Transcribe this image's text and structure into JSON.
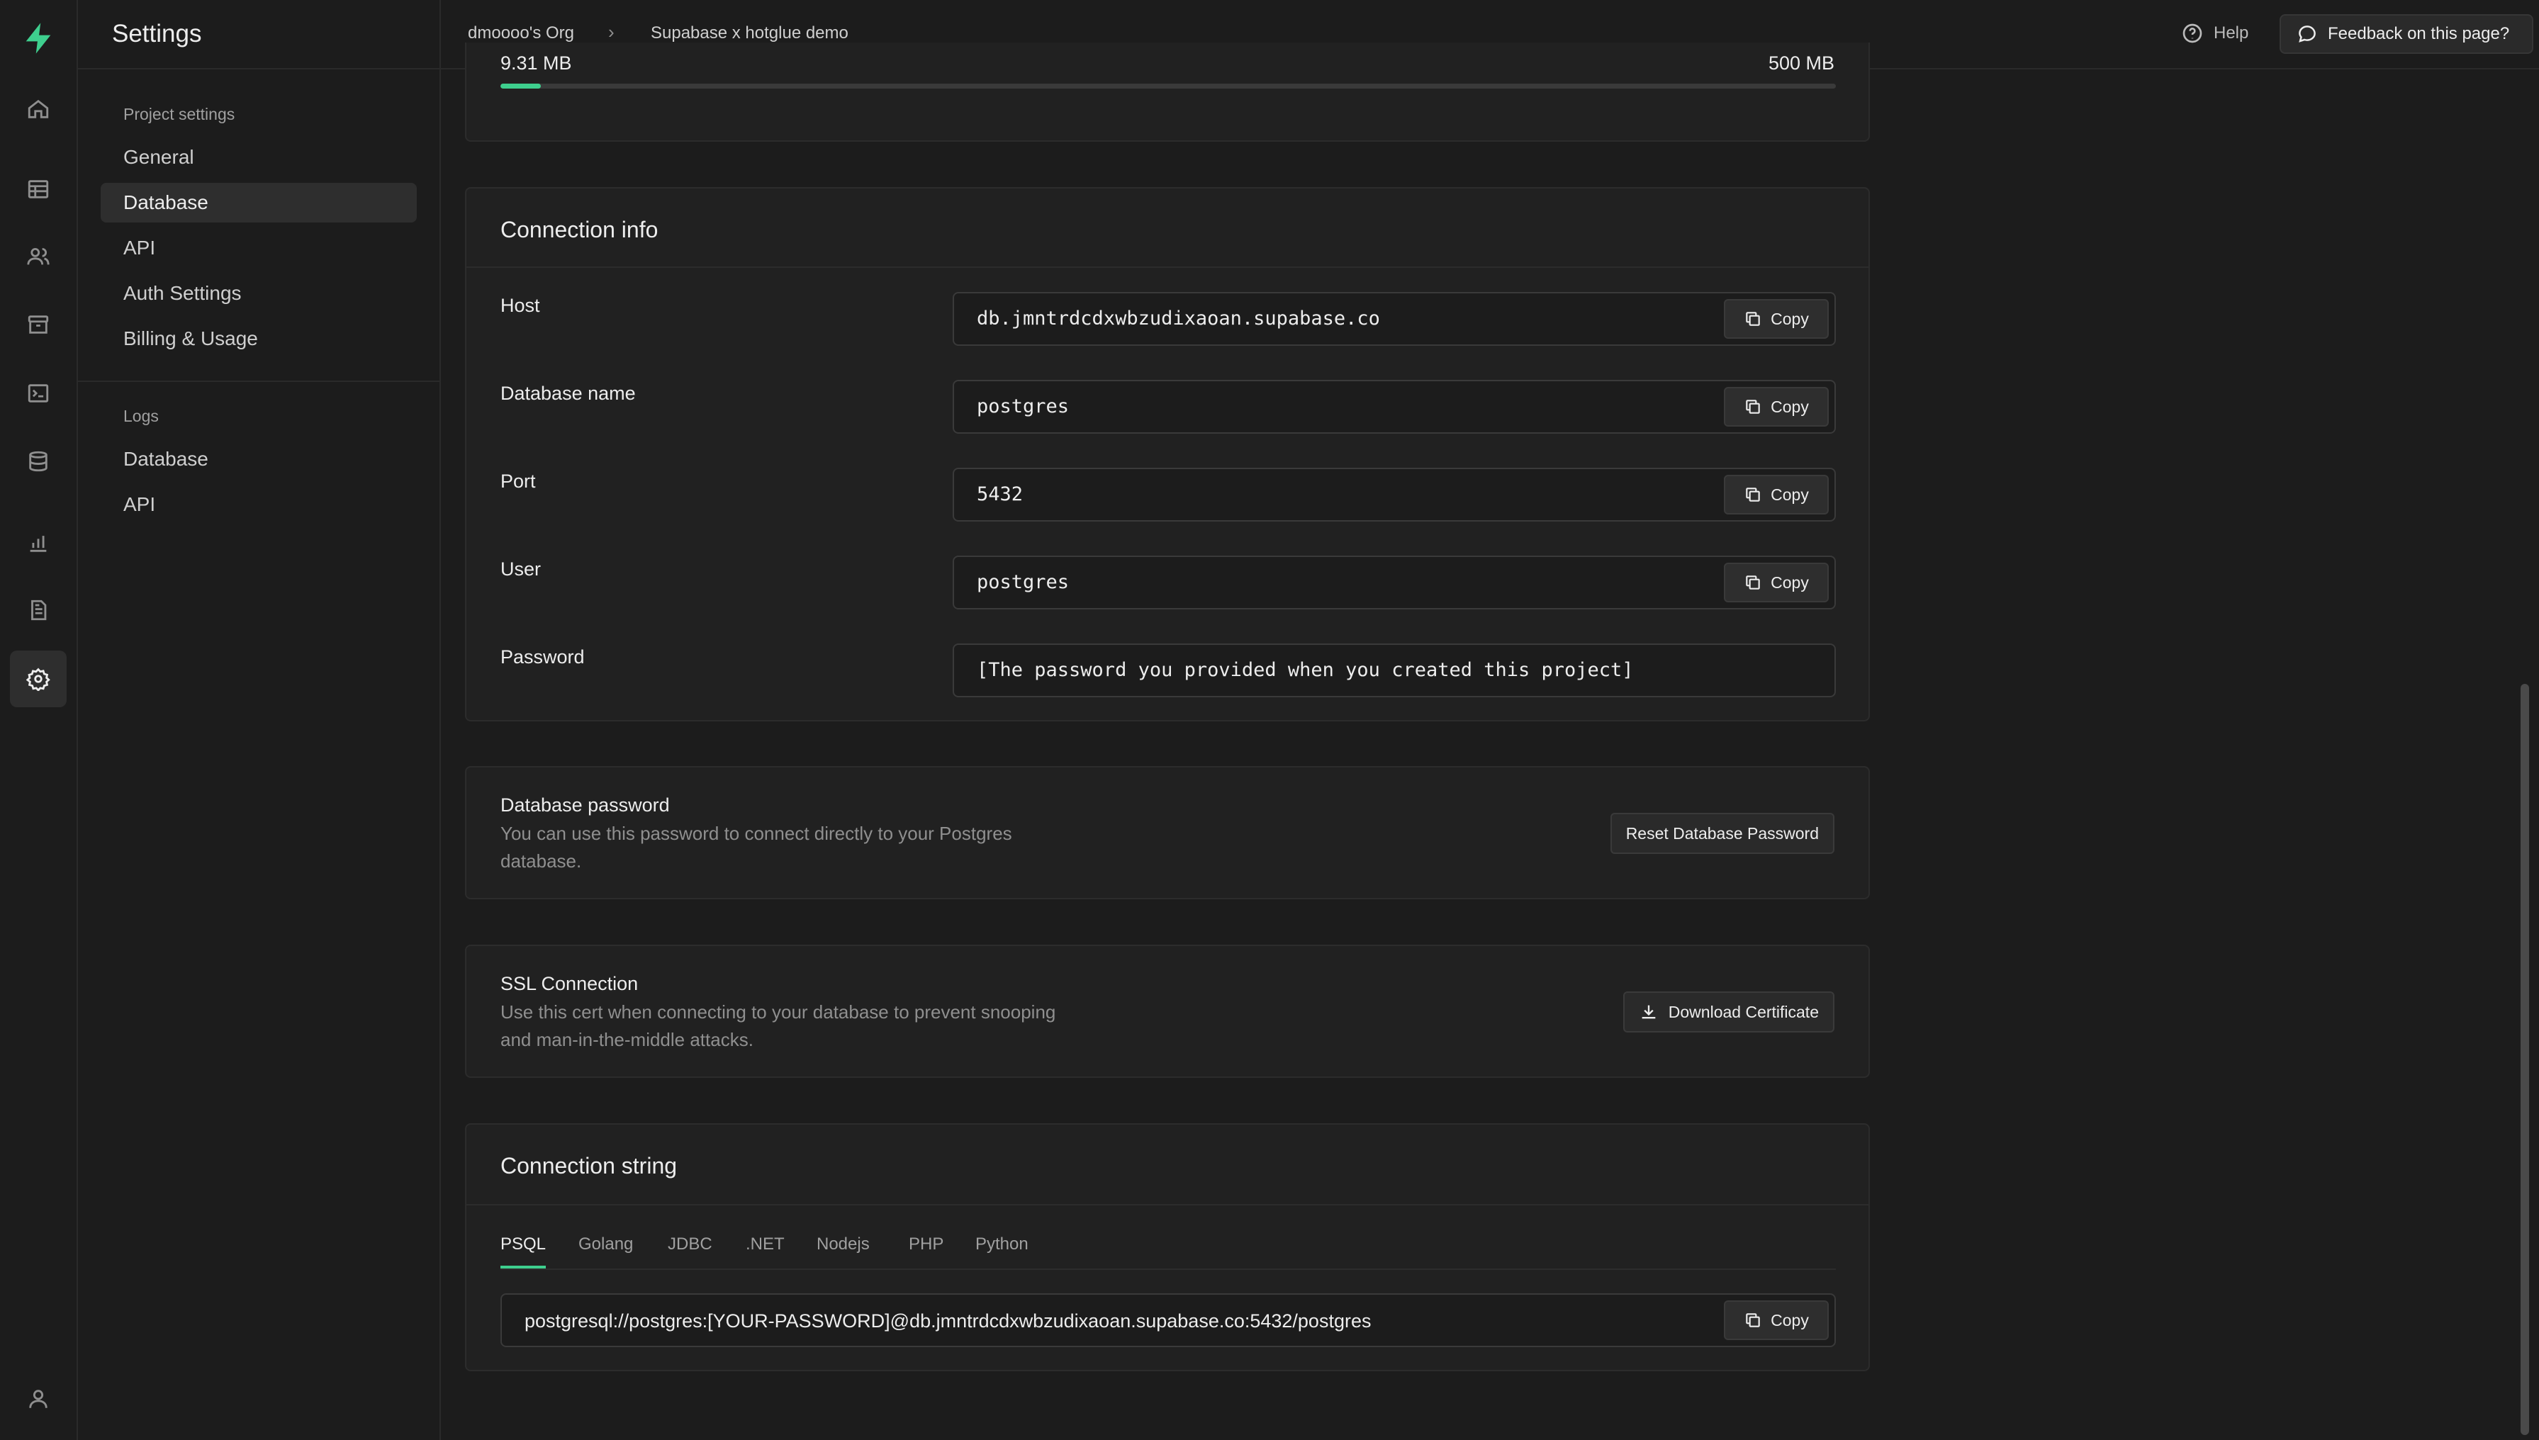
{
  "app": {
    "title": "Settings"
  },
  "rail": {
    "items": [
      "home-icon",
      "table-editor-icon",
      "auth-users-icon",
      "storage-icon",
      "sql-editor-icon",
      "database-icon",
      "reports-icon",
      "api-docs-icon",
      "settings-icon",
      "account-icon"
    ]
  },
  "sidebar": {
    "project_settings_label": "Project settings",
    "project_items": [
      "General",
      "Database",
      "API",
      "Auth Settings",
      "Billing & Usage"
    ],
    "active_item": "Database",
    "logs_label": "Logs",
    "logs_items": [
      "Database",
      "API"
    ]
  },
  "topbar": {
    "org": "dmoooo's Org",
    "separator": "›",
    "project": "Supabase x hotglue demo",
    "help_label": "Help",
    "feedback_label": "Feedback on this page?"
  },
  "usage": {
    "used": "9.31 MB",
    "limit": "500 MB",
    "fraction": 0.0186
  },
  "connection_info": {
    "title": "Connection info",
    "copy_label": "Copy",
    "fields": [
      {
        "label": "Host",
        "value": "db.jmntrdcdxwbzudixaoan.supabase.co",
        "copyable": true
      },
      {
        "label": "Database name",
        "value": "postgres",
        "copyable": true
      },
      {
        "label": "Port",
        "value": "5432",
        "copyable": true
      },
      {
        "label": "User",
        "value": "postgres",
        "copyable": true
      },
      {
        "label": "Password",
        "value": "[The password you provided when you created this project]",
        "copyable": false
      }
    ]
  },
  "db_password": {
    "title": "Database password",
    "description": "You can use this password to connect directly to your Postgres database.",
    "button": "Reset Database Password"
  },
  "ssl": {
    "title": "SSL Connection",
    "description": "Use this cert when connecting to your database to prevent snooping and man-in-the-middle attacks.",
    "button": "Download Certificate"
  },
  "connection_string": {
    "title": "Connection string",
    "tabs": [
      "PSQL",
      "Golang",
      "JDBC",
      ".NET",
      "Nodejs",
      "PHP",
      "Python"
    ],
    "active_tab": "PSQL",
    "value": "postgresql://postgres:[YOUR-PASSWORD]@db.jmntrdcdxwbzudixaoan.supabase.co:5432/postgres",
    "copy_label": "Copy"
  },
  "colors": {
    "accent": "#3ecf8e",
    "background": "#1c1c1c",
    "panel": "#212121"
  }
}
